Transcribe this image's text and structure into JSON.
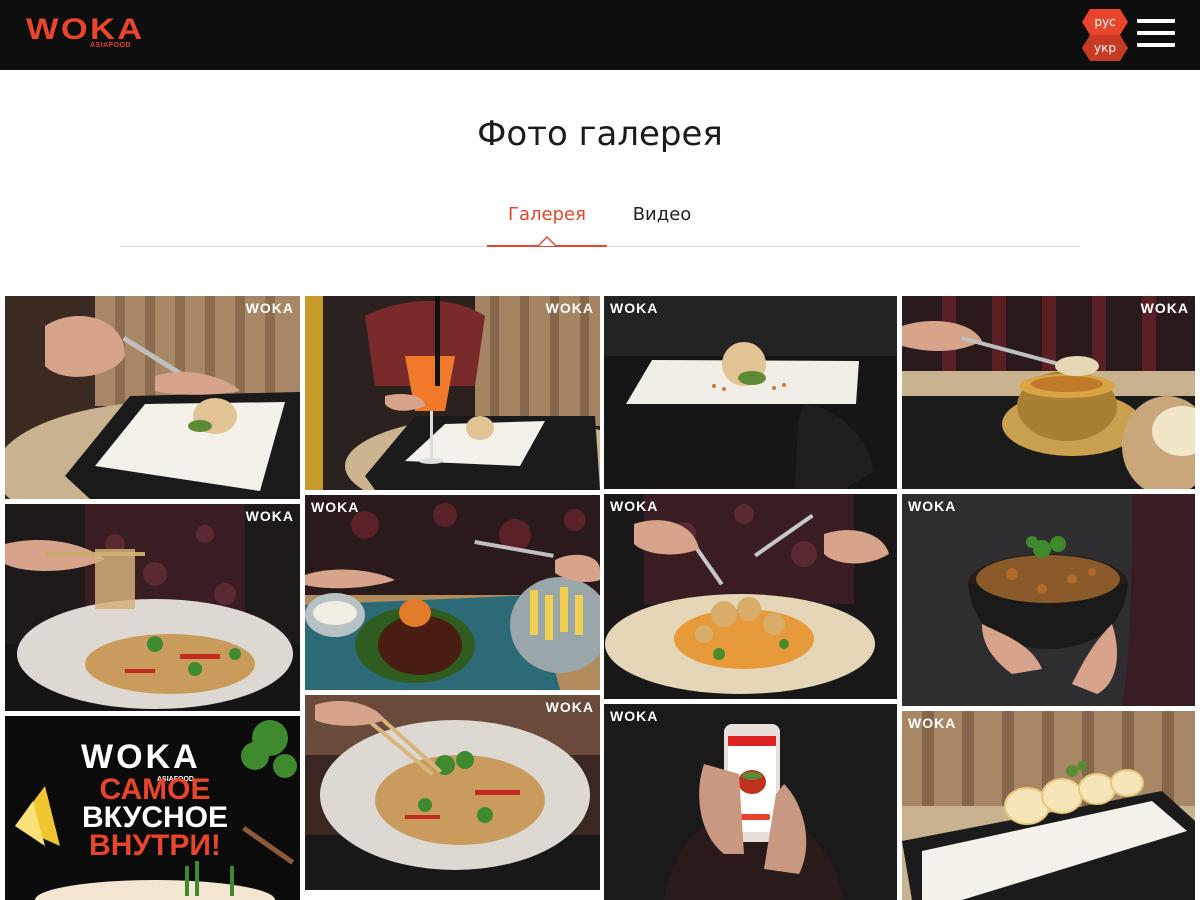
{
  "header": {
    "logo": "WOKA",
    "logo_sub": "ASIAFOOD",
    "lang_ru": "рус",
    "lang_uk": "укр"
  },
  "page": {
    "title": "Фото галерея"
  },
  "tabs": {
    "gallery": "Галерея",
    "video": "Видео",
    "active": "gallery"
  },
  "gallery": {
    "watermark": "WOKA",
    "promo": {
      "logo": "WOKA",
      "logo_sub": "ASIAFOOD",
      "line1": "САМОЕ",
      "line2": "ВКУСНОЕ",
      "line3": "ВНУТРИ!"
    }
  },
  "colors": {
    "accent": "#e8452c",
    "header_bg": "#0e0e0e"
  }
}
